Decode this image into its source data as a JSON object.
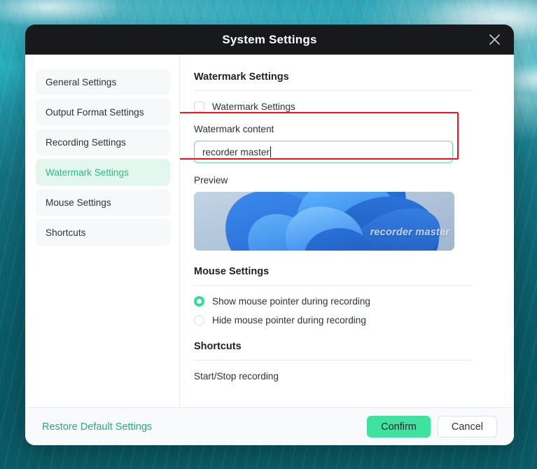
{
  "window": {
    "title": "System Settings",
    "close_icon": "close-icon"
  },
  "sidebar": {
    "items": [
      {
        "label": "General Settings",
        "active": false
      },
      {
        "label": "Output Format Settings",
        "active": false
      },
      {
        "label": "Recording Settings",
        "active": false
      },
      {
        "label": "Watermark Settings",
        "active": true
      },
      {
        "label": "Mouse Settings",
        "active": false
      },
      {
        "label": "Shortcuts",
        "active": false
      }
    ]
  },
  "content": {
    "watermark": {
      "section_title": "Watermark Settings",
      "toggle_label": "Watermark Settings",
      "toggle_checked": false,
      "field_label": "Watermark content",
      "field_value": "recorder master",
      "preview_label": "Preview",
      "preview_watermark_text": "recorder master"
    },
    "mouse": {
      "section_title": "Mouse Settings",
      "options": [
        {
          "label": "Show mouse pointer during recording",
          "selected": true
        },
        {
          "label": "Hide mouse pointer during recording",
          "selected": false
        }
      ]
    },
    "shortcuts": {
      "section_title": "Shortcuts",
      "rows": [
        {
          "label": "Start/Stop recording"
        }
      ]
    }
  },
  "footer": {
    "restore_label": "Restore Default Settings",
    "confirm_label": "Confirm",
    "cancel_label": "Cancel"
  },
  "colors": {
    "accent_green": "#3fe29f",
    "active_nav_text": "#2fbb87",
    "active_nav_bg": "#e3f7ee",
    "annotation_red": "#fc0d1b",
    "titlebar": "#17191b",
    "desktop_teal": "#14707f"
  }
}
